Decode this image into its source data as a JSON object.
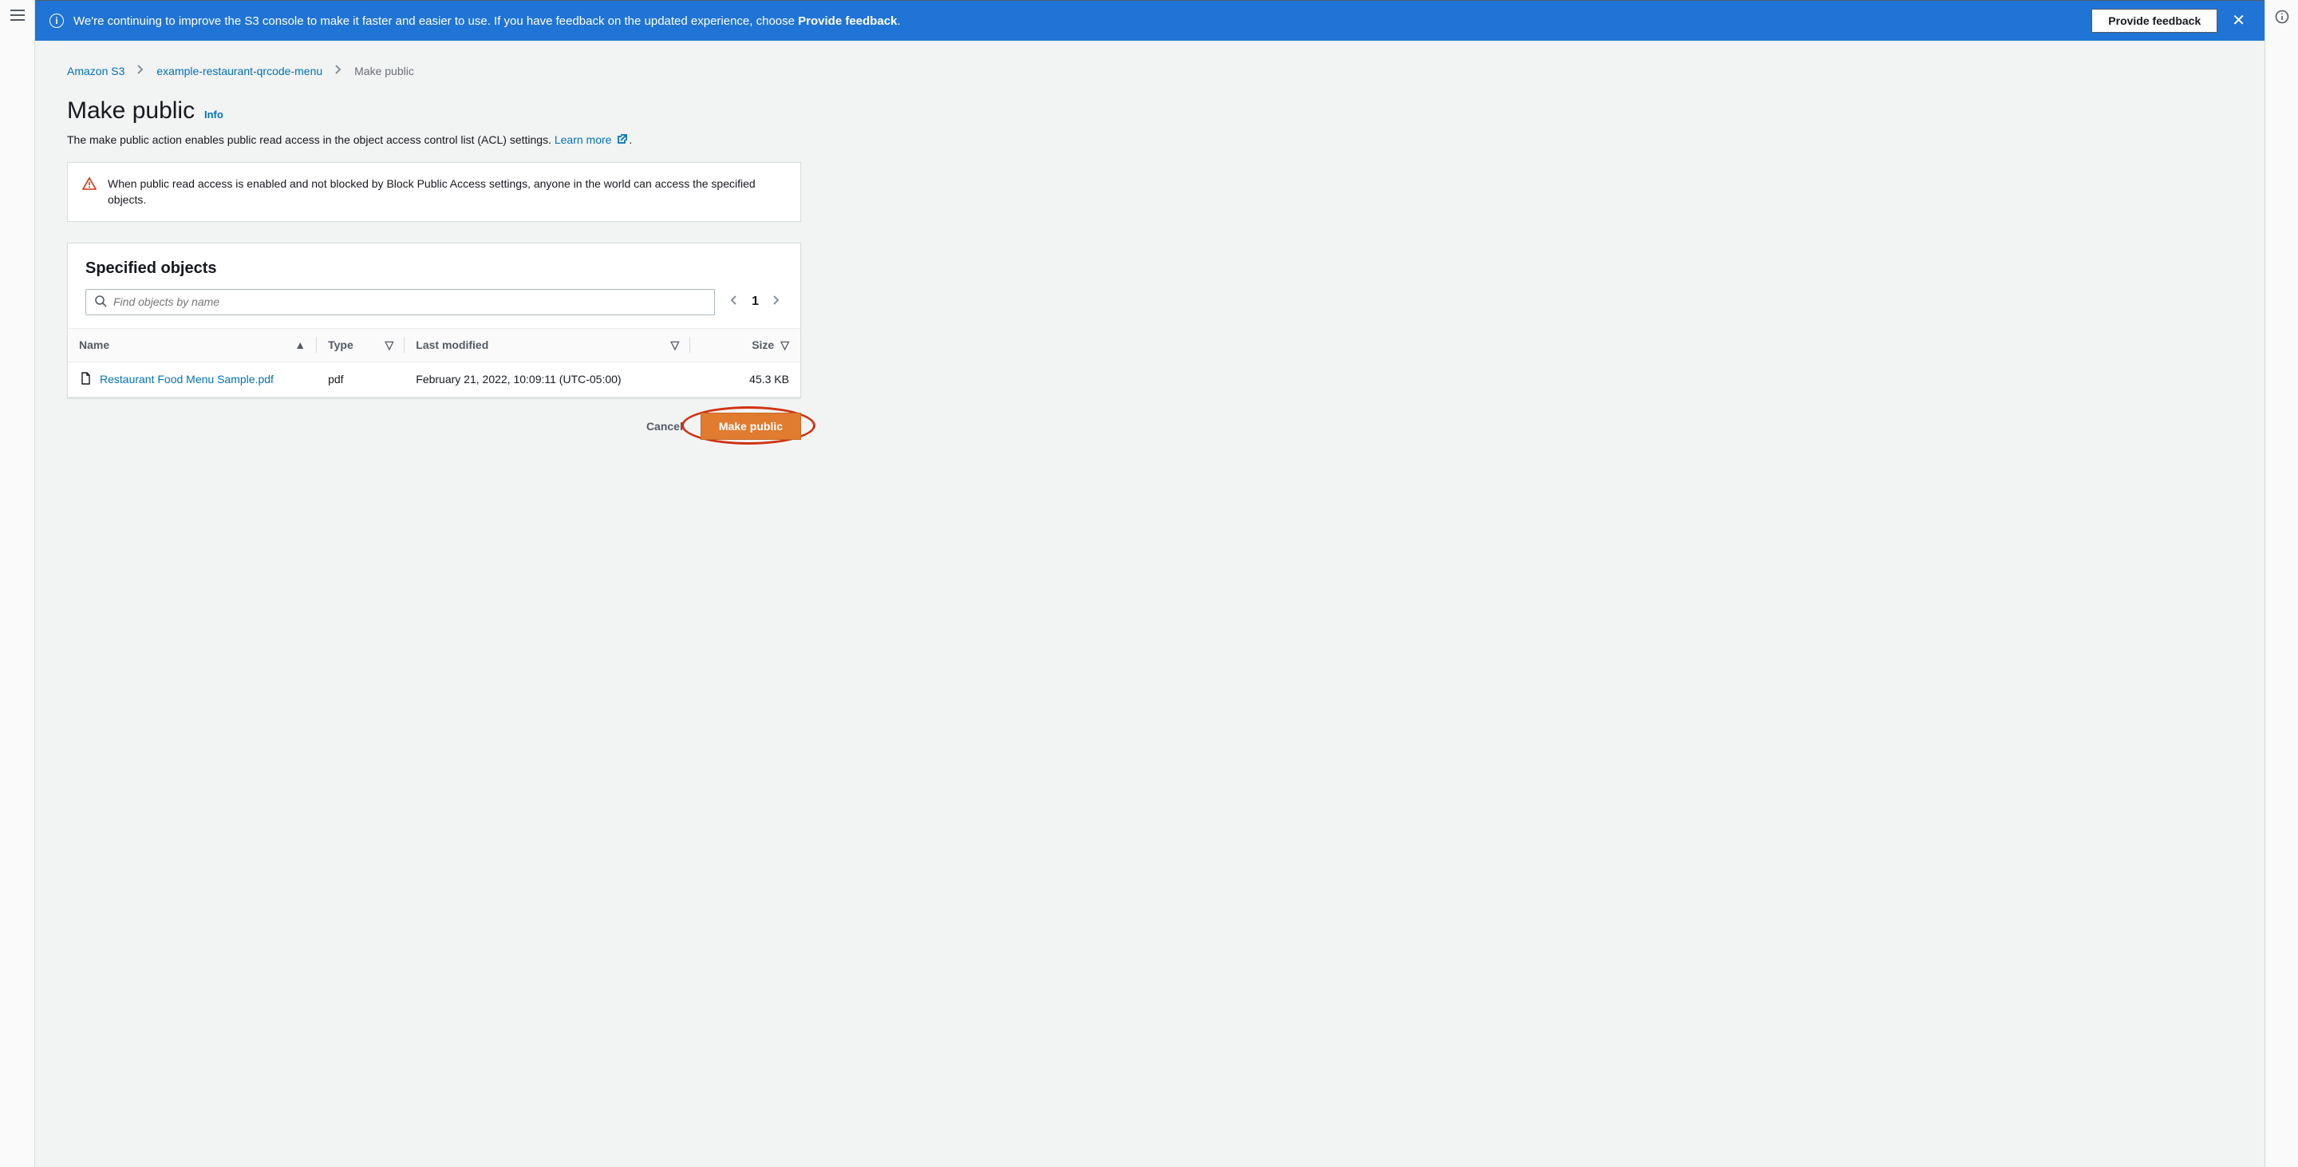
{
  "banner": {
    "text_prefix": "We're continuing to improve the S3 console to make it faster and easier to use. If you have feedback on the updated experience, choose ",
    "text_bold": "Provide feedback",
    "text_suffix": ".",
    "button_label": "Provide feedback"
  },
  "breadcrumbs": {
    "root": "Amazon S3",
    "bucket": "example-restaurant-qrcode-menu",
    "current": "Make public"
  },
  "page": {
    "title": "Make public",
    "info_label": "Info",
    "description_prefix": "The make public action enables public read access in the object access control list (ACL) settings. ",
    "learn_more_label": "Learn more",
    "description_suffix": "."
  },
  "alert": {
    "text": "When public read access is enabled and not blocked by Block Public Access settings, anyone in the world can access the specified objects."
  },
  "objects_panel": {
    "heading": "Specified objects",
    "search_placeholder": "Find objects by name",
    "page_number": "1",
    "columns": {
      "name": "Name",
      "type": "Type",
      "last_modified": "Last modified",
      "size": "Size"
    },
    "rows": [
      {
        "name": "Restaurant Food Menu Sample.pdf",
        "type": "pdf",
        "last_modified": "February 21, 2022, 10:09:11 (UTC-05:00)",
        "size": "45.3 KB"
      }
    ]
  },
  "actions": {
    "cancel": "Cancel",
    "make_public": "Make public"
  }
}
